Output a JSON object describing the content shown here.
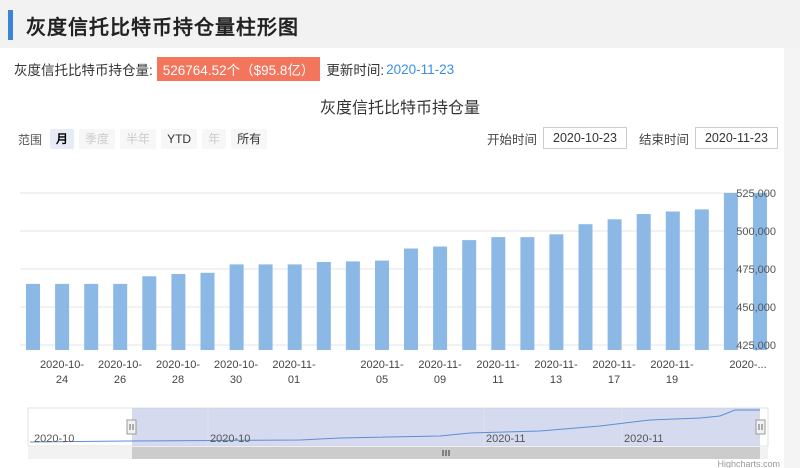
{
  "header": {
    "title": "灰度信托比特币持仓量柱形图"
  },
  "info": {
    "holding_label": "灰度信托比特币持仓量:",
    "holding_value": "526764.52个（$95.8亿）",
    "update_label": "更新时间:",
    "update_date": "2020-11-23"
  },
  "range_selector": {
    "label": "范围",
    "buttons": [
      {
        "label": "月",
        "state": "active"
      },
      {
        "label": "季度",
        "state": "disabled"
      },
      {
        "label": "半年",
        "state": "disabled"
      },
      {
        "label": "YTD",
        "state": "normal"
      },
      {
        "label": "年",
        "state": "disabled"
      },
      {
        "label": "所有",
        "state": "normal"
      }
    ]
  },
  "date_inputs": {
    "start_label": "开始时间",
    "start_value": "2020-10-23",
    "end_label": "结束时间",
    "end_value": "2020-11-23"
  },
  "navigator": {
    "labels": [
      "2020-10",
      "2020-10",
      "2020-11",
      "2020-11"
    ],
    "scroll_icon": "grip-icon"
  },
  "credit": "Highcharts.com",
  "colors": {
    "bar": "#8cb8e6",
    "accent": "#3b84d8",
    "badge": "#f2755c",
    "date": "#3a8ee6"
  },
  "chart_data": {
    "type": "bar",
    "title": "灰度信托比特币持仓量",
    "xlabel": "",
    "ylabel": "",
    "ylim": [
      425000,
      525000
    ],
    "yticks": [
      "425,000",
      "450,000",
      "475,000",
      "500,000",
      "525,000"
    ],
    "grid": true,
    "x_tick_labels": [
      [
        "2020-10-",
        "24"
      ],
      [
        "2020-10-",
        "26"
      ],
      [
        "2020-10-",
        "28"
      ],
      [
        "2020-10-",
        "30"
      ],
      [
        "2020-11-",
        "01"
      ],
      [
        "2020-11-",
        "05"
      ],
      [
        "2020-11-",
        "09"
      ],
      [
        "2020-11-",
        "11"
      ],
      [
        "2020-11-",
        "13"
      ],
      [
        "2020-11-",
        "17"
      ],
      [
        "2020-11-",
        "19"
      ],
      [
        "2020-...",
        ""
      ]
    ],
    "values": [
      465200,
      465200,
      465200,
      465200,
      470200,
      471700,
      472500,
      478000,
      478000,
      478000,
      479600,
      480000,
      480500,
      488500,
      489800,
      494000,
      496000,
      496000,
      497800,
      504500,
      507700,
      511200,
      512800,
      514200,
      525000,
      525000
    ]
  }
}
